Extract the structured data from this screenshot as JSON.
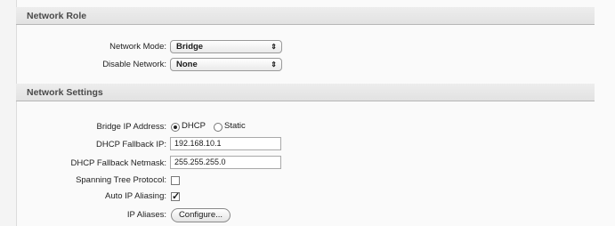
{
  "network_role": {
    "title": "Network Role",
    "network_mode": {
      "label": "Network Mode:",
      "value": "Bridge"
    },
    "disable_network": {
      "label": "Disable Network:",
      "value": "None"
    }
  },
  "network_settings": {
    "title": "Network Settings",
    "bridge_ip": {
      "label": "Bridge IP Address:",
      "options": [
        "DHCP",
        "Static"
      ],
      "selected": "DHCP"
    },
    "dhcp_fallback_ip": {
      "label": "DHCP Fallback IP:",
      "value": "192.168.10.1"
    },
    "dhcp_fallback_netmask": {
      "label": "DHCP Fallback Netmask:",
      "value": "255.255.255.0"
    },
    "stp": {
      "label": "Spanning Tree Protocol:",
      "checked": false
    },
    "auto_ip_aliasing": {
      "label": "Auto IP Aliasing:",
      "checked": true
    },
    "ip_aliases": {
      "label": "IP Aliases:",
      "button": "Configure..."
    }
  }
}
